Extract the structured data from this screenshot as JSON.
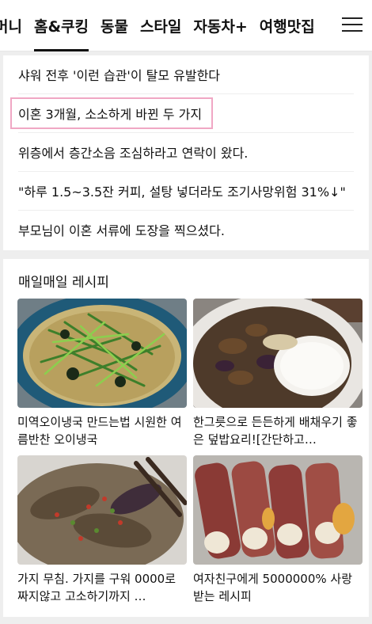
{
  "nav": {
    "tabs": [
      "머니",
      "홈&쿠킹",
      "동물",
      "스타일",
      "자동차+",
      "여행맛집"
    ],
    "active_index": 1
  },
  "news": {
    "items": [
      "샤워 전후 '이런 습관'이 탈모 유발한다",
      "이혼 3개월, 소소하게 바뀐 두 가지",
      "위층에서 층간소음 조심하라고 연락이 왔다.",
      "\"하루 1.5~3.5잔 커피, 설탕 넣더라도 조기사망위험 31%↓\"",
      "부모님이 이혼 서류에 도장을 찍으셨다."
    ],
    "highlighted_index": 1
  },
  "recipes": {
    "title": "매일매일 레시피",
    "items": [
      {
        "caption": "미역오이냉국 만드는법 시원한 여름반찬 오이냉국",
        "image": "cold-cucumber-seaweed-soup"
      },
      {
        "caption": "한그릇으로 든든하게 배채우기 좋은 덮밥요리![간단하고…",
        "image": "eggplant-rice-bowl"
      },
      {
        "caption": "가지 무침. 가지를 구워 0000로 짜지않고 고소하기까지 …",
        "image": "seasoned-eggplant"
      },
      {
        "caption": "여자친구에게 5000000% 사랑 받는 레시피",
        "image": "bacon-rice-rolls"
      }
    ]
  }
}
